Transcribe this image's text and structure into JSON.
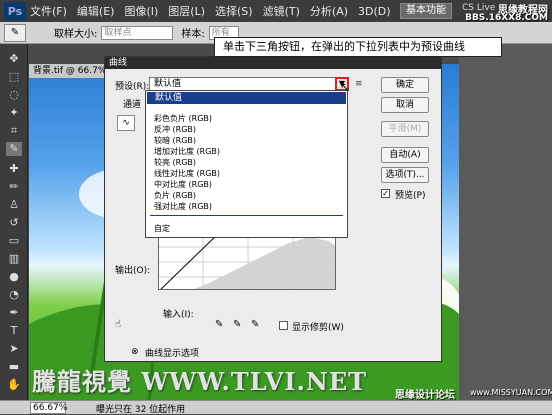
{
  "menubar": {
    "app_logo": "Ps",
    "items": [
      "文件(F)",
      "编辑(E)",
      "图像(I)",
      "图层(L)",
      "选择(S)",
      "滤镜(T)",
      "分析(A)",
      "3D(D)"
    ],
    "workspace_button": "基本功能",
    "cslive": "CS Live",
    "watermark_1": "思缘教程网",
    "watermark_2": "BBS.16XX8.COM"
  },
  "options_bar": {
    "sample_size_label": "取样大小:",
    "sample_size_value": "取样点",
    "sample_label": "样本:",
    "sample_value": "所有图层"
  },
  "document": {
    "tab_title": "背景.tif @ 66.7%"
  },
  "callout": {
    "text": "单击下三角按钮，在弹出的下拉列表中为预设曲线"
  },
  "dialog": {
    "title": "曲线",
    "preset_label": "预设(R):",
    "preset_value": "默认值",
    "channel_label": "通道",
    "ok": "确定",
    "cancel": "取消",
    "smooth": "平滑(M)",
    "auto": "自动(A)",
    "options": "选项(T)...",
    "preview_label": "预览(P)",
    "preview_checked": true,
    "output_label": "输出(O):",
    "input_label": "输入(I):",
    "show_clipping": "显示修剪(W)",
    "curve_display_options": "曲线显示选项"
  },
  "dropdown": {
    "selected": "默认值",
    "items": [
      "彩色负片 (RGB)",
      "反冲 (RGB)",
      "较暗 (RGB)",
      "增加对比度 (RGB)",
      "较亮 (RGB)",
      "线性对比度 (RGB)",
      "中对比度 (RGB)",
      "负片 (RGB)",
      "强对比度 (RGB)"
    ],
    "custom": "自定"
  },
  "status": {
    "zoom": "66.67%",
    "info": "曝光只在 32 位起作用"
  },
  "watermarks": {
    "bottom_left": "騰龍視覺 WWW.TLVI.NET",
    "bottom_right": "思缘设计论坛",
    "bottom_right_2": "www.MISSYUAN.COM"
  },
  "colors": {
    "accent": "#1a3f8a",
    "highlight_box": "#e02020"
  }
}
